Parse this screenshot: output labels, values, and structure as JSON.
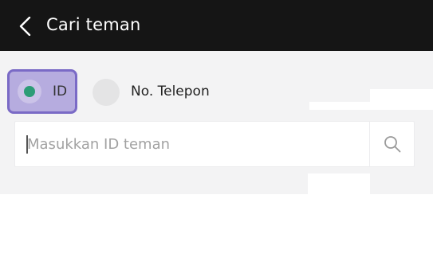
{
  "header": {
    "title": "Cari teman",
    "back_icon": "chevron-left-icon"
  },
  "search_type": {
    "options": [
      {
        "label": "ID",
        "selected": true
      },
      {
        "label": "No. Telepon",
        "selected": false
      }
    ]
  },
  "search": {
    "placeholder": "Masukkan ID teman",
    "value": "",
    "icon": "search-icon"
  },
  "colors": {
    "header_bg": "#151515",
    "accent": "#2c9c76",
    "selected_highlight": "#7a6ac6"
  }
}
